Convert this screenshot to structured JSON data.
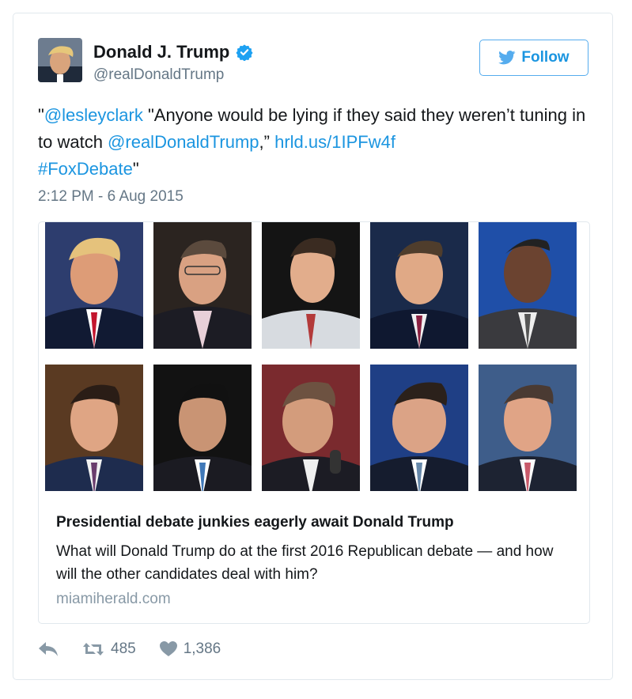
{
  "user": {
    "name": "Donald J. Trump",
    "handle": "@realDonaldTrump",
    "verified": true
  },
  "follow_label": "Follow",
  "tweet": {
    "open_quote": "\"",
    "mention": "@lesleyclark",
    "text_part1": " \"Anyone would be lying if they said they weren’t tuning in to watch ",
    "mention2": "@realDonaldTrump",
    "text_part2": ",” ",
    "link": "hrld.us/1IPFw4f",
    "hashtag": "#FoxDebate",
    "close_quote": "\"",
    "timestamp": "2:12 PM - 6 Aug 2015"
  },
  "card": {
    "title": "Presidential debate junkies eagerly await Donald Trump",
    "description": "What will Donald Trump do at the first 2016 Republican debate — and how will the other candidates deal with him?",
    "domain": "miamiherald.com"
  },
  "actions": {
    "retweets": "485",
    "likes": "1,386"
  },
  "colors": {
    "link": "#1b95e0",
    "muted": "#657786",
    "border": "#e1e8ed"
  }
}
